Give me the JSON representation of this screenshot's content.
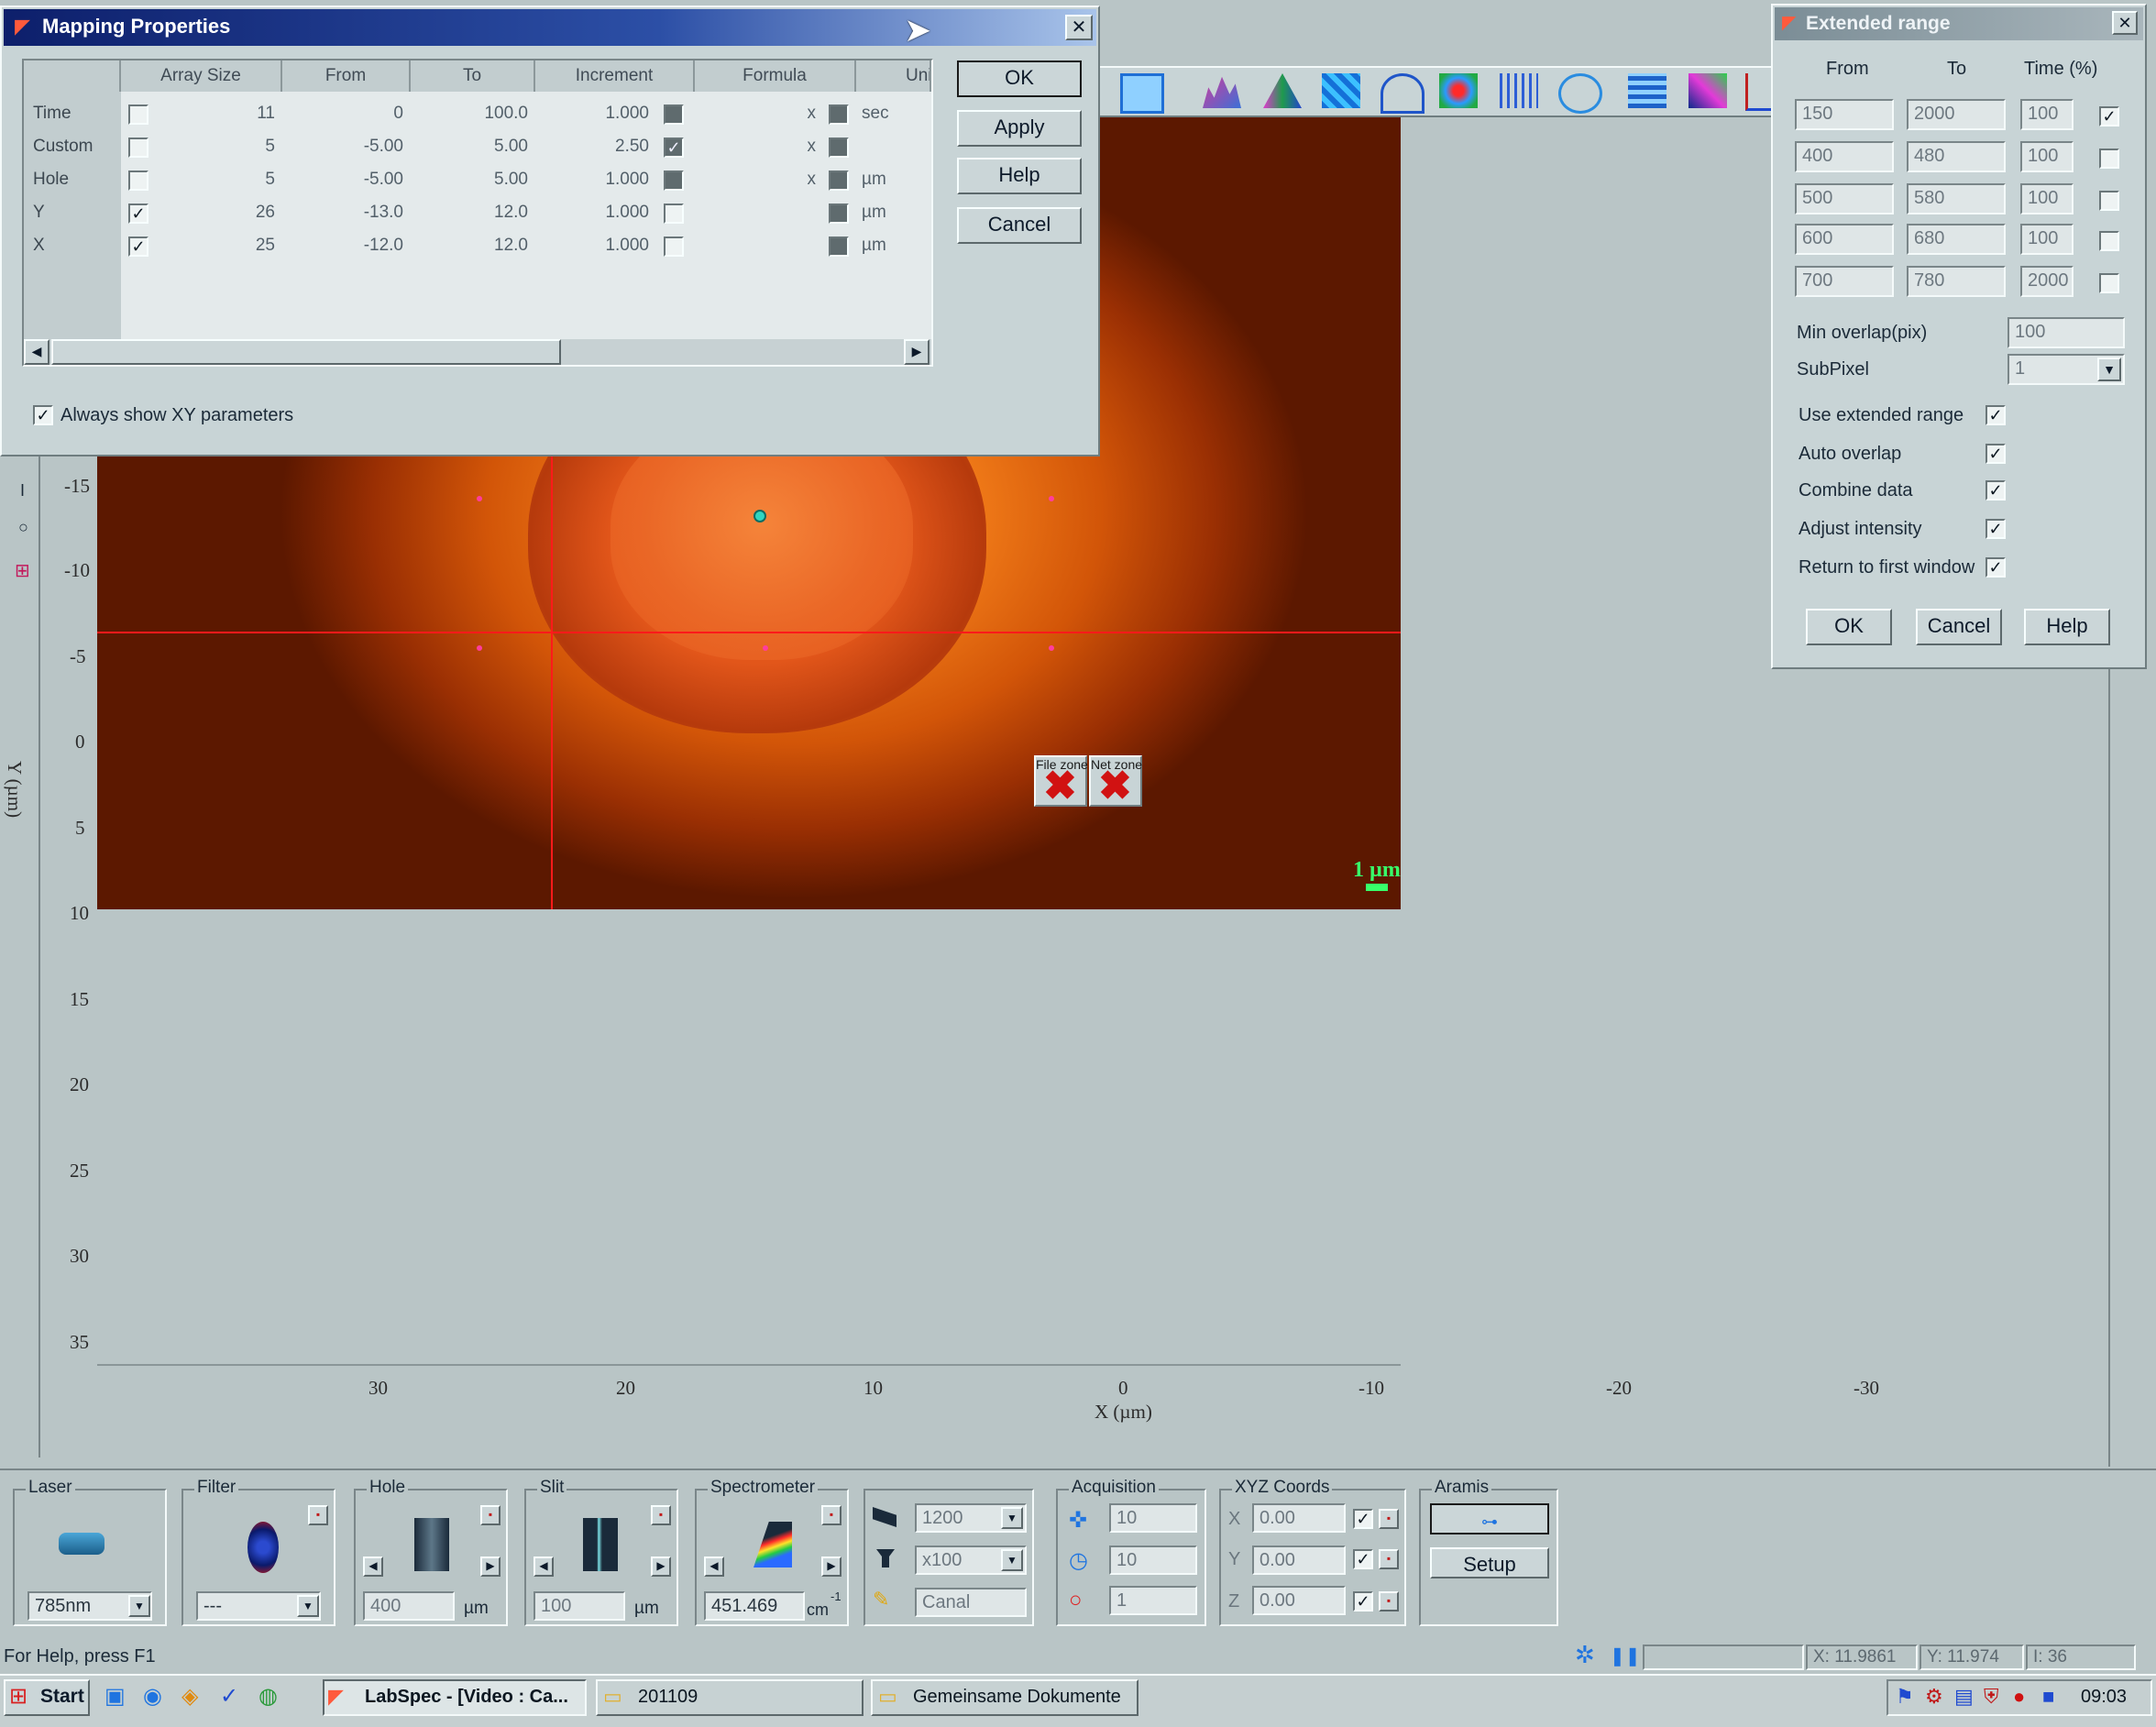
{
  "mapping_dialog": {
    "title": "Mapping Properties",
    "columns": [
      "Array Size",
      "From",
      "To",
      "Increment",
      "Formula",
      "Unit"
    ],
    "rows": [
      {
        "label": "Time",
        "checked": false,
        "array_size": "11",
        "from": "0",
        "to": "100.0",
        "increment": "1.000",
        "inc_checked": false,
        "formula": "x",
        "unit_checked": false,
        "unit": "sec"
      },
      {
        "label": "Custom",
        "checked": false,
        "array_size": "5",
        "from": "-5.00",
        "to": "5.00",
        "increment": "2.50",
        "inc_checked": true,
        "formula": "x",
        "unit_checked": false,
        "unit": ""
      },
      {
        "label": "Hole",
        "checked": false,
        "array_size": "5",
        "from": "-5.00",
        "to": "5.00",
        "increment": "1.000",
        "inc_checked": false,
        "formula": "x",
        "unit_checked": false,
        "unit": "µm"
      },
      {
        "label": "Y",
        "checked": true,
        "array_size": "26",
        "from": "-13.0",
        "to": "12.0",
        "increment": "1.000",
        "inc_checked": false,
        "formula": "",
        "unit_checked": false,
        "unit": "µm"
      },
      {
        "label": "X",
        "checked": true,
        "array_size": "25",
        "from": "-12.0",
        "to": "12.0",
        "increment": "1.000",
        "inc_checked": false,
        "formula": "",
        "unit_checked": false,
        "unit": "µm"
      }
    ],
    "buttons": {
      "ok": "OK",
      "apply": "Apply",
      "help": "Help",
      "cancel": "Cancel"
    },
    "always_show": "Always show XY parameters",
    "always_show_checked": true,
    "close": "✕"
  },
  "extended_dialog": {
    "title": "Extended range",
    "headers": {
      "from": "From",
      "to": "To",
      "time": "Time (%)"
    },
    "rows": [
      {
        "from": "150",
        "to": "2000",
        "time": "100",
        "checked": true
      },
      {
        "from": "400",
        "to": "480",
        "time": "100",
        "checked": false
      },
      {
        "from": "500",
        "to": "580",
        "time": "100",
        "checked": false
      },
      {
        "from": "600",
        "to": "680",
        "time": "100",
        "checked": false
      },
      {
        "from": "700",
        "to": "780",
        "time": "2000",
        "checked": false
      }
    ],
    "min_overlap_label": "Min overlap(pix)",
    "min_overlap_value": "100",
    "subpixel_label": "SubPixel",
    "subpixel_value": "1",
    "options": [
      {
        "label": "Use extended range",
        "checked": true
      },
      {
        "label": "Auto overlap",
        "checked": true
      },
      {
        "label": "Combine data",
        "checked": true
      },
      {
        "label": "Adjust intensity",
        "checked": true
      },
      {
        "label": "Return to first window",
        "checked": true
      }
    ],
    "buttons": {
      "ok": "OK",
      "cancel": "Cancel",
      "help": "Help"
    },
    "close": "✕"
  },
  "image_view": {
    "y_axis_label": "Y (µm)",
    "x_axis_label": "X (µm)",
    "y_ticks": [
      "-15",
      "-10",
      "-5",
      "0",
      "5",
      "10",
      "15",
      "20",
      "25",
      "30",
      "35"
    ],
    "x_ticks": [
      "30",
      "20",
      "10",
      "0",
      "-10",
      "-20",
      "-30"
    ],
    "scale_bar": "1 µm",
    "file_zone": "File zone",
    "net_zone": "Net zone",
    "colors": {
      "crosshair": "#ff1a1a",
      "scale": "#38ff6a"
    }
  },
  "controls": {
    "laser": {
      "label": "Laser",
      "value": "785nm"
    },
    "filter": {
      "label": "Filter",
      "value": "---"
    },
    "hole": {
      "label": "Hole",
      "value": "400",
      "unit": "µm"
    },
    "slit": {
      "label": "Slit",
      "value": "100",
      "unit": "µm"
    },
    "spectrometer": {
      "label": "Spectrometer",
      "value": "451.469",
      "unit": "cm",
      "unit_sup": "-1"
    },
    "grating": {
      "grating": "1200",
      "objective": "x100",
      "canal": "Canal"
    },
    "acquisition": {
      "label": "Acquisition",
      "values": [
        "10",
        "10",
        "1"
      ]
    },
    "xyz": {
      "label": "XYZ Coords",
      "axes": [
        "X",
        "Y",
        "Z"
      ],
      "values": [
        "0.00",
        "0.00",
        "0.00"
      ]
    },
    "aramis": {
      "label": "Aramis",
      "setup": "Setup"
    }
  },
  "status_bar": {
    "help_text": "For Help, press F1",
    "x_coord": "X: 11.9861",
    "y_coord": "Y: 11.974",
    "i_value": "I: 36"
  },
  "taskbar": {
    "start": "Start",
    "tasks": [
      "LabSpec - [Video : Ca...",
      "201109",
      "Gemeinsame Dokumente"
    ],
    "clock": "09:03"
  }
}
